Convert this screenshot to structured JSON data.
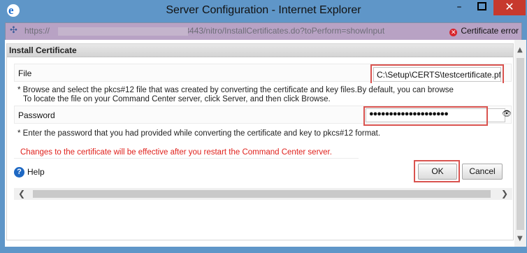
{
  "window": {
    "title": "Server Configuration - Internet Explorer",
    "minimize_symbol": "–",
    "close_symbol": "✕"
  },
  "address_bar": {
    "url_prefix": "https://",
    "url_rest": ":8443/nitro/InstallCertificates.do?toPerform=showInput",
    "certificate_error": "Certificate error",
    "error_symbol": "✕"
  },
  "panel": {
    "header": "Install Certificate",
    "file": {
      "label": "File",
      "value": "C:\\Setup\\CERTS\\testcertificate.pfx"
    },
    "file_note_line1": "* Browse and select the pkcs#12 file that was created by converting the certificate and key files.By default, you can browse",
    "file_note_line2": "To locate the file on your Command Center server, click Server, and then click Browse.",
    "password": {
      "label": "Password",
      "value": "●●●●●●●●●●●●●●●●●●●●"
    },
    "password_note": "* Enter the password that you had provided while converting the certificate and key to pkcs#12 format.",
    "warning": "Changes to the certificate will be effective after you restart the Command Center server.",
    "help_label": "Help",
    "ok_label": "OK",
    "cancel_label": "Cancel"
  },
  "icons": {
    "ie": "internet-explorer-icon",
    "help": "help-icon",
    "eye": "eye-icon"
  },
  "colors": {
    "title_bar": "#5f96c8",
    "close_button": "#c7392d",
    "address_bar": "#b8a2c4",
    "warning_text": "#e0221d",
    "highlight_border": "#d9534f"
  }
}
